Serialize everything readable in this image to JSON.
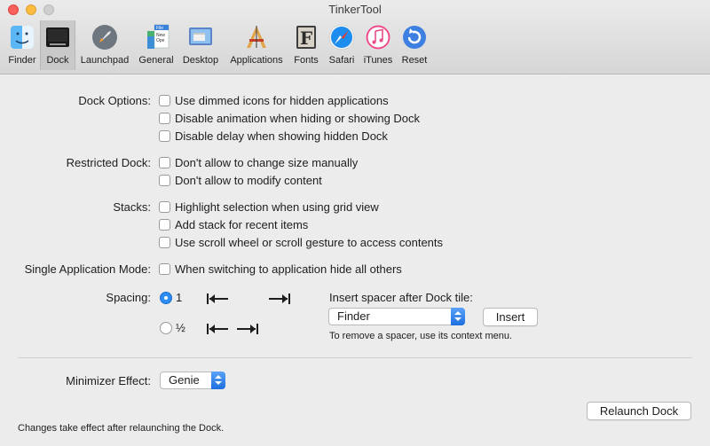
{
  "window": {
    "title": "TinkerTool"
  },
  "toolbar": {
    "items": [
      {
        "label": "Finder",
        "icon": "finder-icon"
      },
      {
        "label": "Dock",
        "icon": "dock-icon",
        "selected": true
      },
      {
        "label": "Launchpad",
        "icon": "launchpad-icon"
      },
      {
        "label": "General",
        "icon": "general-icon"
      },
      {
        "label": "Desktop",
        "icon": "desktop-icon"
      },
      {
        "label": "Applications",
        "icon": "applications-icon"
      },
      {
        "label": "Fonts",
        "icon": "fonts-icon"
      },
      {
        "label": "Safari",
        "icon": "safari-icon"
      },
      {
        "label": "iTunes",
        "icon": "itunes-icon"
      },
      {
        "label": "Reset",
        "icon": "reset-icon"
      }
    ],
    "general_icon_text": [
      "File",
      "New",
      "Ope"
    ],
    "fonts_icon_letter": "F"
  },
  "dock_options": {
    "label": "Dock Options:",
    "items": [
      "Use dimmed icons for hidden applications",
      "Disable animation when hiding or showing Dock",
      "Disable delay when showing hidden Dock"
    ]
  },
  "restricted_dock": {
    "label": "Restricted Dock:",
    "items": [
      "Don't allow to change size manually",
      "Don't allow to modify content"
    ]
  },
  "stacks": {
    "label": "Stacks:",
    "items": [
      "Highlight selection when using grid view",
      "Add stack for recent items",
      "Use scroll wheel or scroll gesture to access contents"
    ]
  },
  "single_app": {
    "label": "Single Application Mode:",
    "item": "When switching to application hide all others"
  },
  "spacing": {
    "label": "Spacing:",
    "option1": "1",
    "option2": "½",
    "selected": "1",
    "insert_label": "Insert spacer after Dock tile:",
    "tile_value": "Finder",
    "insert_button": "Insert",
    "hint": "To remove a spacer, use its context menu."
  },
  "minimizer": {
    "label": "Minimizer Effect:",
    "value": "Genie"
  },
  "footer": {
    "relaunch_button": "Relaunch Dock",
    "note": "Changes take effect after relaunching the Dock."
  },
  "colors": {
    "accent": "#2f8cf2",
    "background": "#ececec"
  }
}
